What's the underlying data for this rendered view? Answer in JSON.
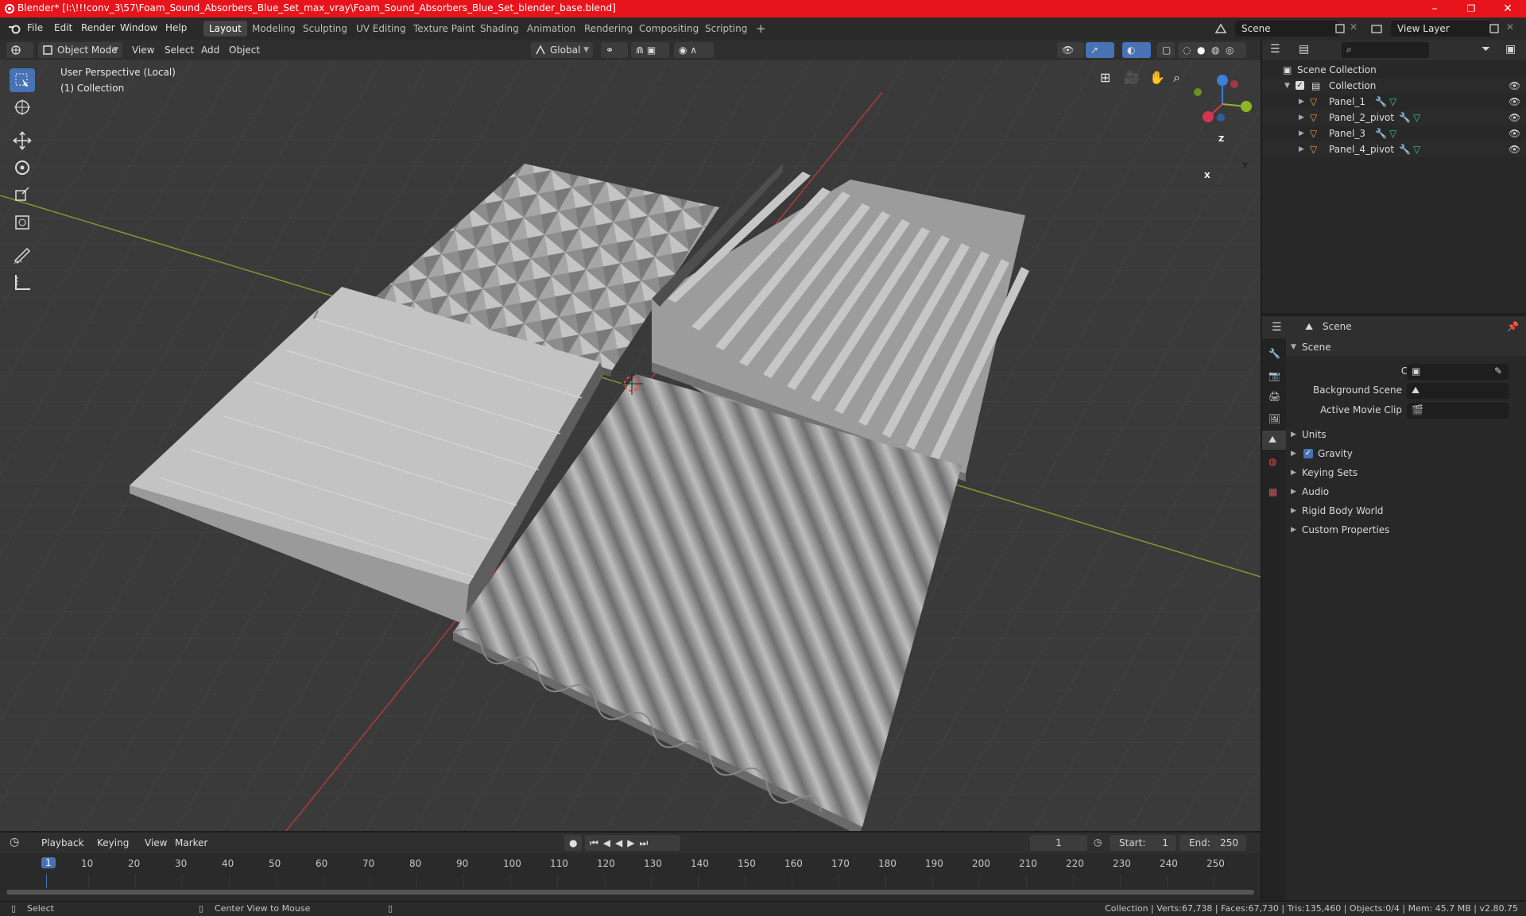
{
  "titlebar": {
    "title": "Blender* [I:\\!!!conv_3\\57\\Foam_Sound_Absorbers_Blue_Set_max_vray\\Foam_Sound_Absorbers_Blue_Set_blender_base.blend]",
    "minimize": "–",
    "maximize": "❐",
    "close": "✕"
  },
  "menubar": {
    "items": [
      "File",
      "Edit",
      "Render",
      "Window",
      "Help"
    ],
    "workspaces": [
      "Layout",
      "Modeling",
      "Sculpting",
      "UV Editing",
      "Texture Paint",
      "Shading",
      "Animation",
      "Rendering",
      "Compositing",
      "Scripting"
    ],
    "add_workspace": "+",
    "scene": "Scene",
    "view_layer": "View Layer"
  },
  "viewport_header": {
    "mode": "Object Mode",
    "menus": [
      "View",
      "Select",
      "Add",
      "Object"
    ],
    "orientation": "Global"
  },
  "viewport": {
    "perspective": "User Perspective (Local)",
    "collection": "(1) Collection",
    "gizmo": {
      "x": "X",
      "y": "Y",
      "z": "Z"
    }
  },
  "outliner": {
    "root": "Scene Collection",
    "collection": "Collection",
    "objects": [
      "Panel_1",
      "Panel_2_pivot",
      "Panel_3",
      "Panel_4_pivot"
    ]
  },
  "properties": {
    "header": "Scene",
    "panel": "Scene",
    "camera_label": "Camera",
    "background_label": "Background Scene",
    "movieclip_label": "Active Movie Clip",
    "sections": [
      "Units",
      "Gravity",
      "Keying Sets",
      "Audio",
      "Rigid Body World",
      "Custom Properties"
    ]
  },
  "timeline": {
    "menus": [
      "Playback",
      "Keying",
      "View",
      "Marker"
    ],
    "current_frame": "1",
    "start_label": "Start:",
    "start": "1",
    "end_label": "End:",
    "end": "250",
    "ticks": [
      "1",
      "10",
      "20",
      "30",
      "40",
      "50",
      "60",
      "70",
      "80",
      "90",
      "100",
      "110",
      "120",
      "130",
      "140",
      "150",
      "160",
      "170",
      "180",
      "190",
      "200",
      "210",
      "220",
      "230",
      "240",
      "250"
    ]
  },
  "statusbar": {
    "select": "Select",
    "center": "Center View to Mouse",
    "stats": "Collection | Verts:67,738 | Faces:67,730 | Tris:135,460 | Objects:0/4 | Mem: 45.7 MB | v2.80.75"
  }
}
